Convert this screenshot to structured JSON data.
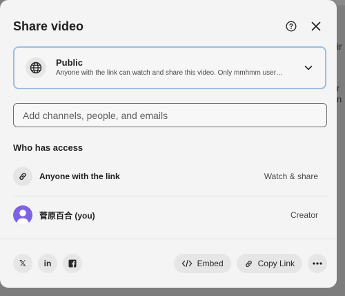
{
  "backdrop": {
    "fragment_a": "ir",
    "fragment_b": "r",
    "fragment_c": "n"
  },
  "dialog": {
    "title": "Share video",
    "help_icon": "help-circle-icon",
    "close_icon": "close-icon"
  },
  "visibility": {
    "icon": "globe-icon",
    "title": "Public",
    "description": "Anyone with the link can watch and share this video. Only mmhmm user…",
    "chevron_icon": "chevron-down-icon",
    "border_color": "#9dbde0"
  },
  "invite": {
    "placeholder": "Add channels, people, and emails",
    "value": ""
  },
  "access": {
    "heading": "Who has access",
    "rows": [
      {
        "icon": "link-icon",
        "label": "Anyone with the link",
        "role": "Watch & share"
      },
      {
        "icon": "avatar",
        "label": "菅原百合 (you)",
        "role": "Creator",
        "avatar_color": "#7d63e0"
      }
    ]
  },
  "footer": {
    "social": [
      {
        "icon": "x-icon",
        "glyph": "𝕏"
      },
      {
        "icon": "linkedin-icon",
        "glyph": "in"
      },
      {
        "icon": "facebook-icon",
        "glyph": "f"
      }
    ],
    "embed_label": "Embed",
    "embed_icon": "code-icon",
    "copy_label": "Copy Link",
    "copy_icon": "link-icon",
    "more_icon": "more-icon"
  }
}
